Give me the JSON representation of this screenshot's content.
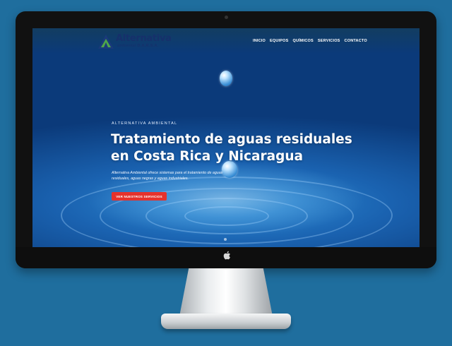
{
  "site": {
    "logo": {
      "title": "Alternativa",
      "subtitle_prefix": "ambiental",
      "subtitle_brand": "D.A.R.S.A."
    },
    "nav": {
      "items": [
        "INICIO",
        "EQUIPOS",
        "QUÍMICOS",
        "SERVICIOS",
        "CONTACTO"
      ]
    },
    "hero": {
      "eyebrow": "ALTERNATIVA AMBIENTAL",
      "title_line1": "Tratamiento de aguas residuales",
      "title_line2": "en Costa Rica y Nicaragua",
      "description": "Alternativa Ambiental ofrece sistemas para el tratamiento de aguas residuales, aguas negras y aguas industriales.",
      "cta_label": "VER NUESTROS SERVICIOS"
    }
  },
  "colors": {
    "background": "#1f6e9e",
    "cta": "#e5322c",
    "logo_text": "#16306b"
  },
  "icons": [
    "apple-logo-icon",
    "logo-triangle-icon"
  ]
}
